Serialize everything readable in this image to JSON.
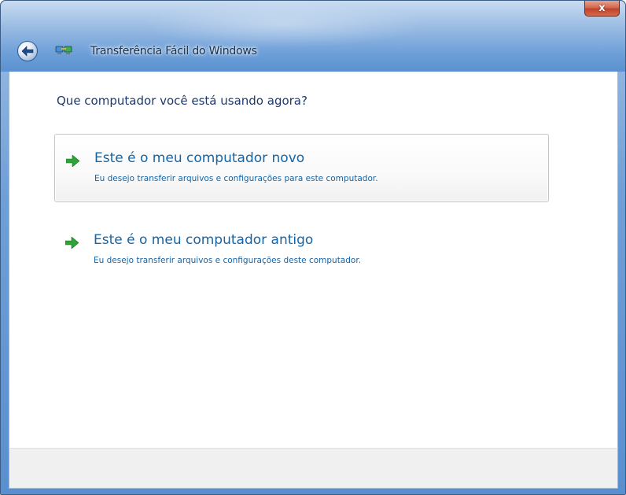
{
  "window": {
    "title": "Transferência Fácil do Windows",
    "close_label": "x"
  },
  "icons": {
    "back": "back-arrow-icon",
    "app": "easy-transfer-icon",
    "option_arrow": "green-arrow-icon"
  },
  "colors": {
    "accent_text": "#1565a6",
    "arrow_green": "#2fa33a",
    "close_red": "#c0432a"
  },
  "main": {
    "question": "Que computador você está usando agora?",
    "options": [
      {
        "title": "Este é o meu computador novo",
        "description": "Eu desejo transferir arquivos e configurações para este computador."
      },
      {
        "title": "Este é o meu computador antigo",
        "description": "Eu desejo transferir arquivos e configurações deste computador."
      }
    ]
  }
}
